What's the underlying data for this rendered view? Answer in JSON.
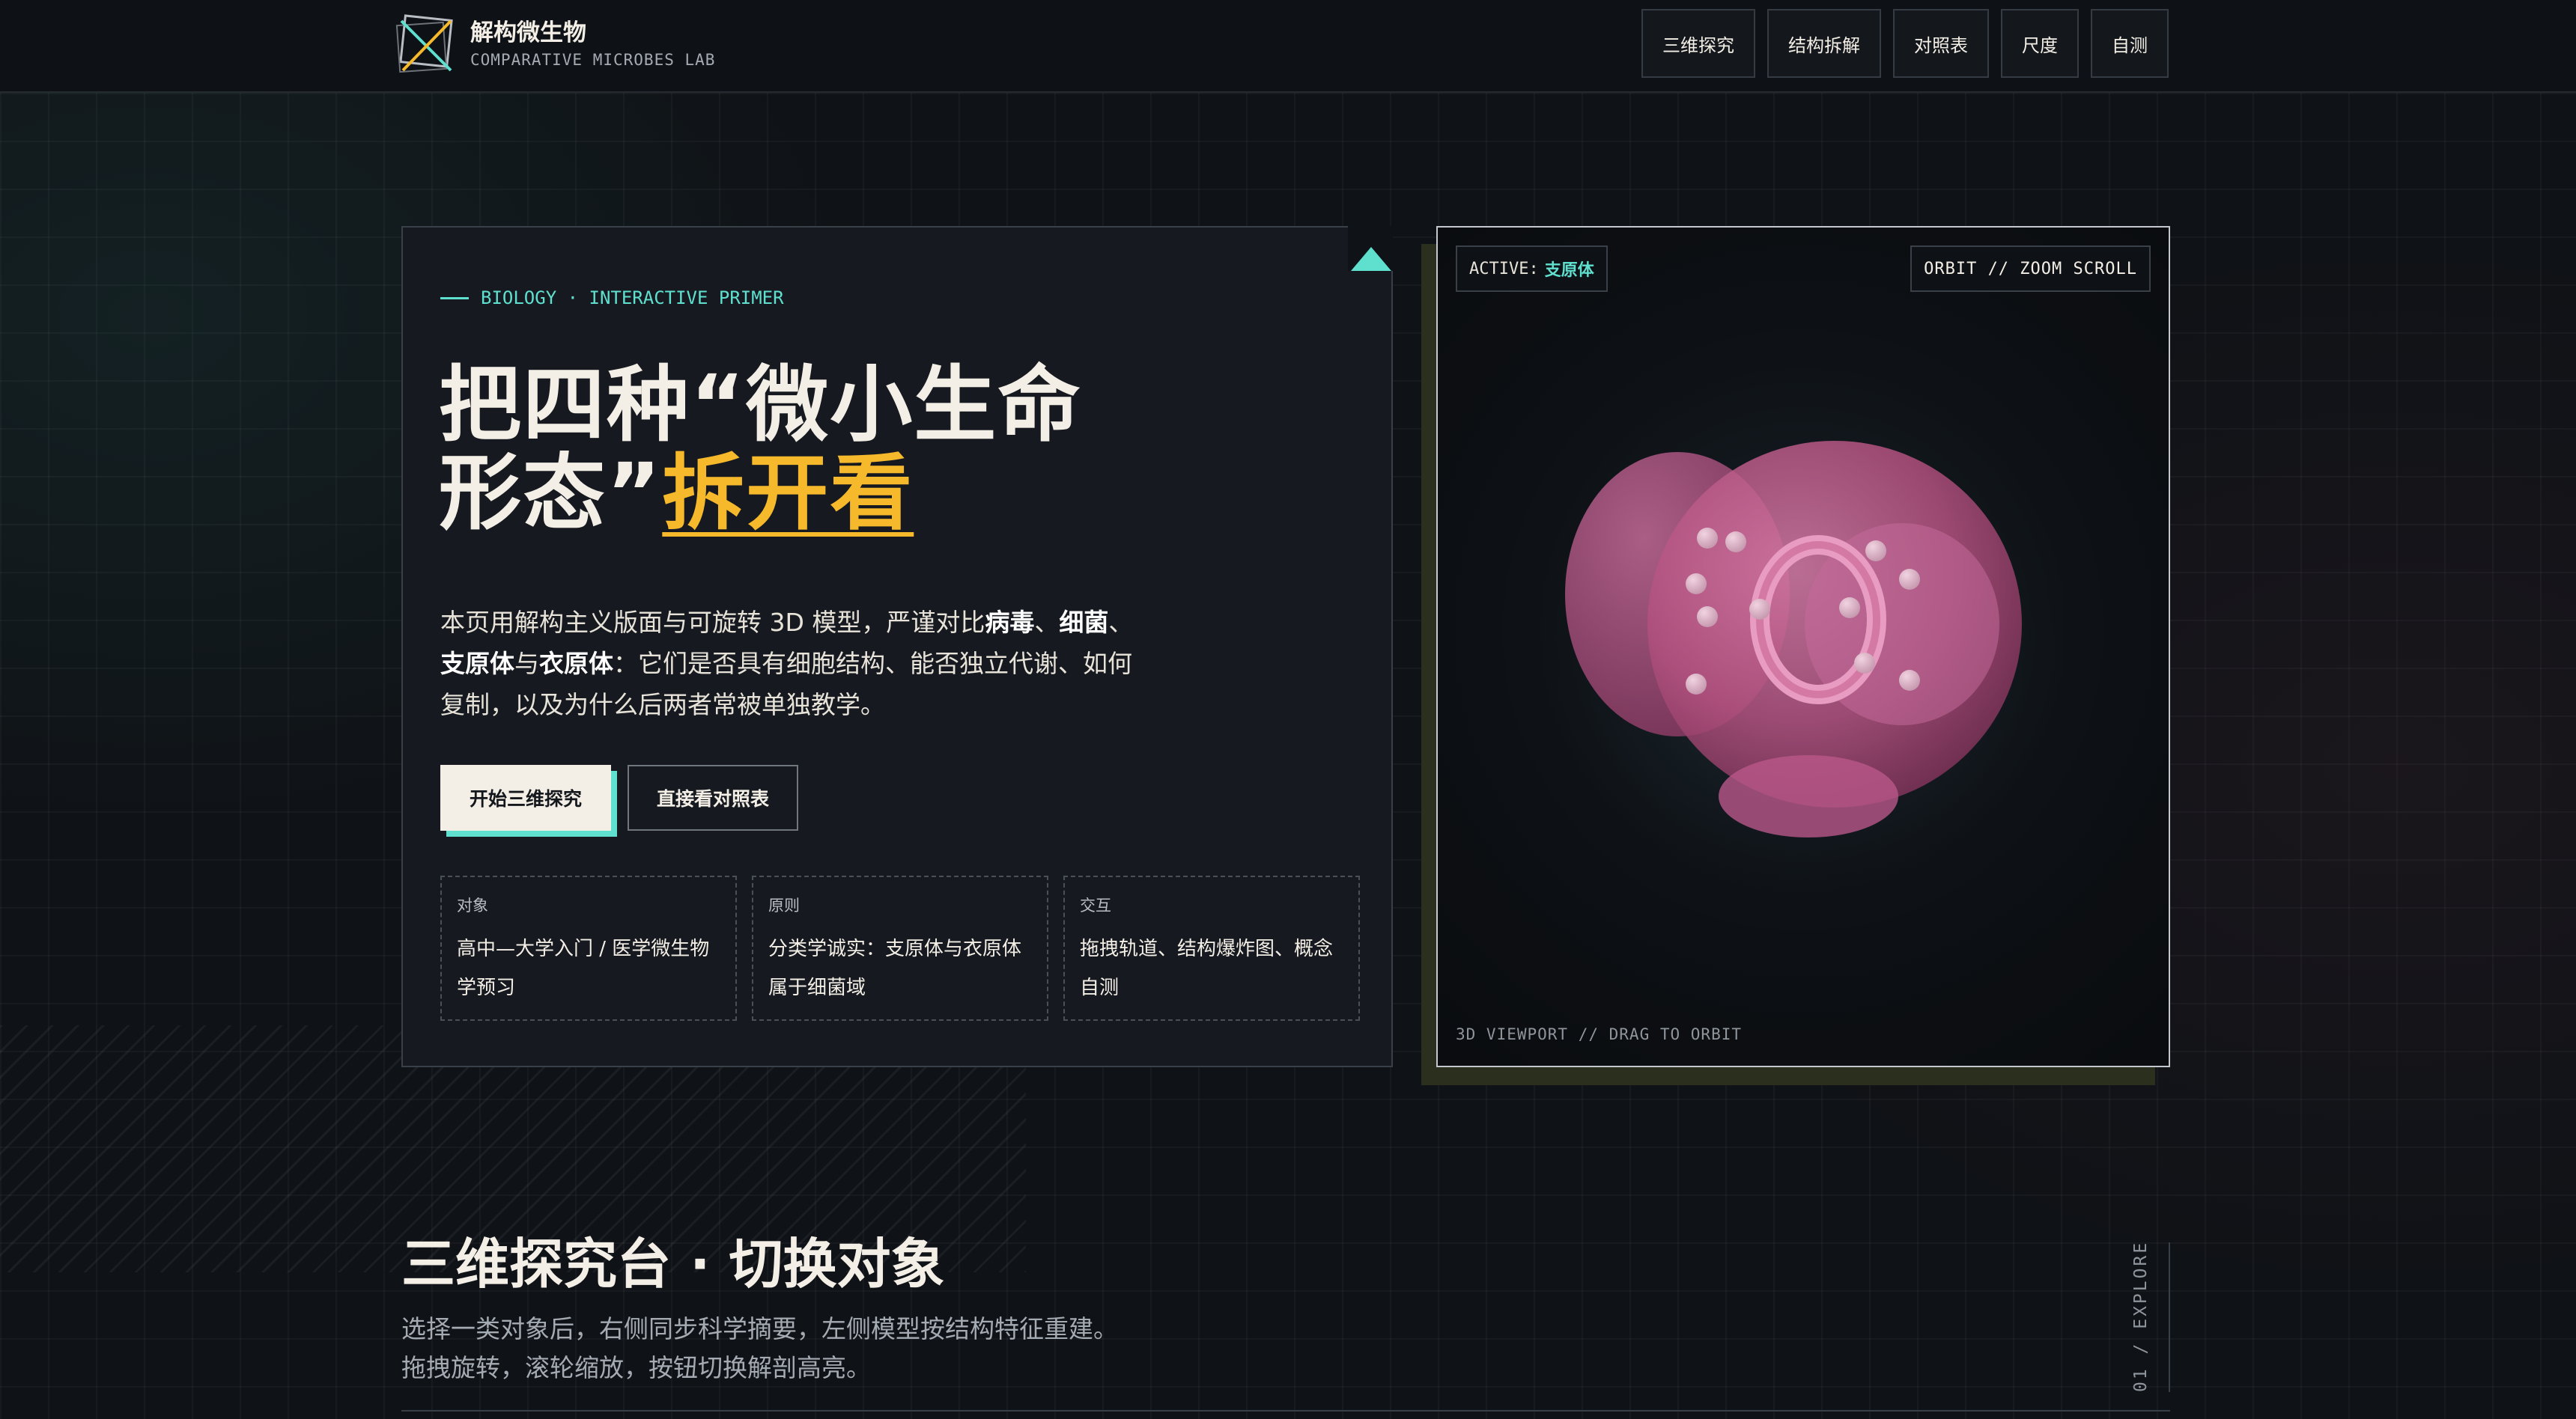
{
  "brand": {
    "title": "解构微生物",
    "subtitle": "COMPARATIVE MICROBES LAB"
  },
  "nav": {
    "items": [
      "三维探究",
      "结构拆解",
      "对照表",
      "尺度",
      "自测"
    ]
  },
  "hero": {
    "eyebrow": "BIOLOGY · INTERACTIVE PRIMER",
    "headline_line1": "把四种“微小生命",
    "headline_line2_pre": "形态”",
    "headline_line2_hl": "拆开看",
    "lede": {
      "p1": "本页用解构主义版面与可旋转 3D 模型，严谨对比",
      "b1": "病毒",
      "s1": "、",
      "b2": "细菌",
      "s2": "、",
      "b3": "支原体",
      "s3": "与",
      "b4": "衣原体",
      "p2": "：它们是否具有细胞结构、能否独立代谢、如何复制，以及为什么后两者常被单独教学。"
    },
    "primary_button": "开始三维探究",
    "secondary_button": "直接看对照表",
    "facts": [
      {
        "label": "对象",
        "value": "高中—大学入门 / 医学微生物学预习"
      },
      {
        "label": "原则",
        "value": "分类学诚实：支原体与衣原体属于细菌域"
      },
      {
        "label": "交互",
        "value": "拖拽轨道、结构爆炸图、概念自测"
      }
    ]
  },
  "viewport": {
    "active_label": "ACTIVE:",
    "active_value": "支原体",
    "hint": "ORBIT // ZOOM SCROLL",
    "caption": "3D VIEWPORT // DRAG TO ORBIT"
  },
  "section": {
    "title": "三维探究台 · 切换对象",
    "desc_line1": "选择一类对象后，右侧同步科学摘要，左侧模型按结构特征重建。",
    "desc_line2": "拖拽旋转，滚轮缩放，按钮切换解剖高亮。",
    "tag": "01 / EXPLORE"
  },
  "colors": {
    "accent_teal": "#5fe0cf",
    "accent_yellow": "#f6b92b",
    "model_pink": "#c95a8f"
  }
}
